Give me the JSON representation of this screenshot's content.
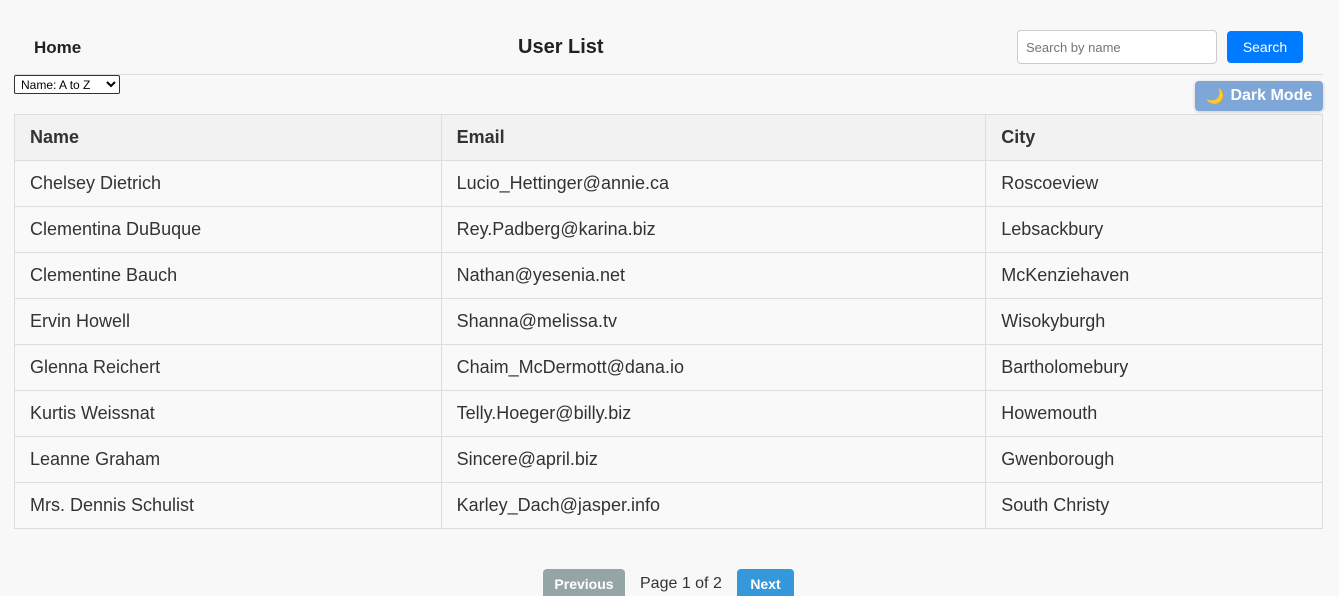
{
  "navbar": {
    "home_label": "Home",
    "title": "User List",
    "search_placeholder": "Search by name",
    "search_value": "",
    "search_button_label": "Search"
  },
  "sort": {
    "selected_label": "Name: A to Z"
  },
  "theme_toggle": {
    "icon": "moon-icon",
    "icon_glyph": "🌙",
    "label": "Dark Mode"
  },
  "table": {
    "headers": {
      "name": "Name",
      "email": "Email",
      "city": "City"
    },
    "rows": [
      {
        "name": "Chelsey Dietrich",
        "email": "Lucio_Hettinger@annie.ca",
        "city": "Roscoeview"
      },
      {
        "name": "Clementina DuBuque",
        "email": "Rey.Padberg@karina.biz",
        "city": "Lebsackbury"
      },
      {
        "name": "Clementine Bauch",
        "email": "Nathan@yesenia.net",
        "city": "McKenziehaven"
      },
      {
        "name": "Ervin Howell",
        "email": "Shanna@melissa.tv",
        "city": "Wisokyburgh"
      },
      {
        "name": "Glenna Reichert",
        "email": "Chaim_McDermott@dana.io",
        "city": "Bartholomebury"
      },
      {
        "name": "Kurtis Weissnat",
        "email": "Telly.Hoeger@billy.biz",
        "city": "Howemouth"
      },
      {
        "name": "Leanne Graham",
        "email": "Sincere@april.biz",
        "city": "Gwenborough"
      },
      {
        "name": "Mrs. Dennis Schulist",
        "email": "Karley_Dach@jasper.info",
        "city": "South Christy"
      }
    ]
  },
  "pagination": {
    "previous_label": "Previous",
    "page_info": "Page 1 of 2",
    "next_label": "Next"
  },
  "colors": {
    "primary": "#007bff",
    "dark_mode_button": "#7ea6d6",
    "previous_disabled": "#95a5a6",
    "next": "#3498db"
  }
}
